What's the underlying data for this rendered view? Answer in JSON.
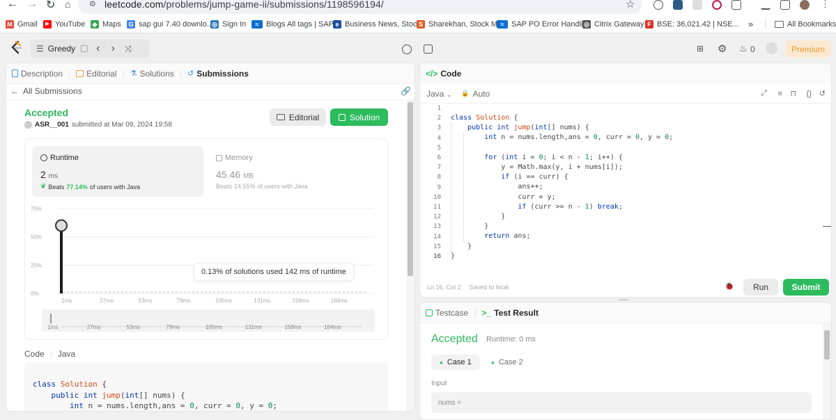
{
  "browser": {
    "url_host": "leetcode.com",
    "url_path": "/problems/jump-game-ii/submissions/1198596194/",
    "bookmarks": [
      {
        "label": "Gmail",
        "color": "#ea4335",
        "glyph": "M"
      },
      {
        "label": "YouTube",
        "color": "#ff0000",
        "glyph": "▶"
      },
      {
        "label": "Maps",
        "color": "#34a853",
        "glyph": "◆"
      },
      {
        "label": "sap gui 7.40 downlo...",
        "color": "#4285f4",
        "glyph": "G"
      },
      {
        "label": "Sign In",
        "color": "#2b7bb9",
        "glyph": "◎"
      },
      {
        "label": "Blogs All tags | SAP...",
        "color": "#0a6ed1",
        "glyph": "≈"
      },
      {
        "label": "Business News, Stoc...",
        "color": "#1a4ea0",
        "glyph": "e"
      },
      {
        "label": "Sharekhan, Stock M...",
        "color": "#e25c2a",
        "glyph": "S"
      },
      {
        "label": "SAP PO Error Handli...",
        "color": "#0a6ed1",
        "glyph": "≈"
      },
      {
        "label": "Citrix Gateway",
        "color": "#555555",
        "glyph": "◎"
      },
      {
        "label": "BSE: 36,021.42 | NSE...",
        "color": "#d93025",
        "glyph": "F"
      }
    ],
    "all_bookmarks": "All Bookmarks",
    "more": "»"
  },
  "topnav": {
    "problem_list": "Greedy",
    "streak": "0",
    "premium": "Premium"
  },
  "left_tabs": {
    "description": "Description",
    "editorial": "Editorial",
    "solutions": "Solutions",
    "submissions": "Submissions"
  },
  "submission": {
    "back": "All Submissions",
    "status": "Accepted",
    "user": "ASR__001",
    "submitted_at": "submitted at Mar 09, 2024 19:58",
    "editorial_btn": "Editorial",
    "solution_btn": "Solution"
  },
  "runtime": {
    "label": "Runtime",
    "value": "2",
    "unit": "ms",
    "beats_prefix": "Beats",
    "beats_pct": "77.14%",
    "beats_suffix": "of users with Java"
  },
  "memory": {
    "label": "Memory",
    "value": "45.46",
    "unit": "MB",
    "beats_prefix": "Beats",
    "beats_pct": "24.55%",
    "beats_suffix": "of users with Java"
  },
  "chart_data": {
    "type": "bar",
    "y_ticks": [
      "75%",
      "50%",
      "25%",
      "0%"
    ],
    "ylim": [
      0,
      75
    ],
    "x_ticks": [
      "1ms",
      "27ms",
      "53ms",
      "79ms",
      "105ms",
      "131ms",
      "158ms",
      "184ms"
    ],
    "highlight": {
      "x": "1ms",
      "y": 60
    },
    "tooltip": "0.13% of solutions used 142 ms of runtime"
  },
  "code_section": {
    "label": "Code",
    "lang": "Java"
  },
  "editor": {
    "title": "Code",
    "language": "Java",
    "mode": "Auto",
    "line_numbers": [
      "1",
      "2",
      "3",
      "4",
      "5",
      "6",
      "7",
      "8",
      "9",
      "10",
      "11",
      "12",
      "13",
      "14",
      "15",
      "16"
    ],
    "status_pos": "Ln 16, Col 2",
    "status_saved": "Saved to local",
    "run": "Run",
    "submit": "Submit"
  },
  "bottom": {
    "testcase_tab": "Testcase",
    "result_tab": "Test Result",
    "status": "Accepted",
    "runtime": "Runtime: 0 ms",
    "case1": "Case 1",
    "case2": "Case 2",
    "input_label": "Input",
    "input_value": "nums ="
  }
}
